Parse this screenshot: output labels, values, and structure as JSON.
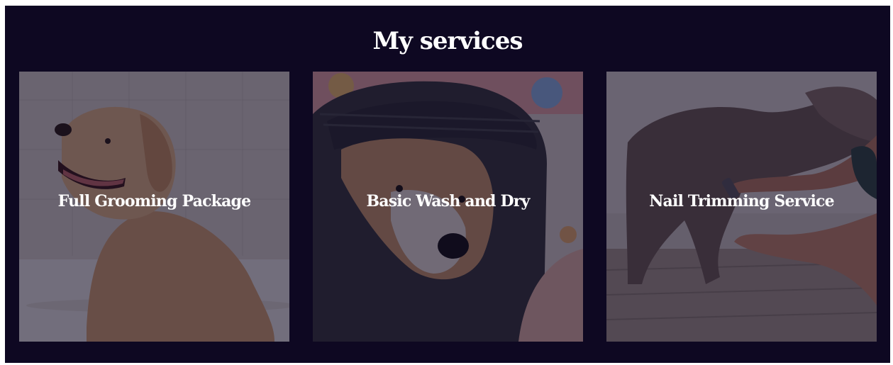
{
  "section": {
    "title": "My services"
  },
  "services": [
    {
      "label": "Full Grooming Package",
      "icon": "golden-retriever-photo"
    },
    {
      "label": "Basic Wash and Dry",
      "icon": "dog-in-towel-photo"
    },
    {
      "label": "Nail Trimming Service",
      "icon": "dog-nail-trim-photo"
    }
  ],
  "colors": {
    "background": "#0e0822",
    "text": "#ffffff"
  }
}
